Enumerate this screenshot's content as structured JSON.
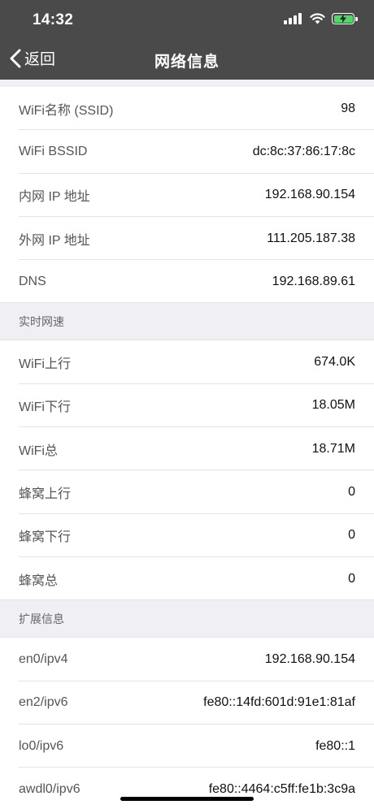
{
  "status_bar": {
    "time": "14:32"
  },
  "nav": {
    "back_label": "返回",
    "title": "网络信息"
  },
  "wifi_info": [
    {
      "label": "WiFi名称 (SSID)",
      "value": "98"
    },
    {
      "label": "WiFi BSSID",
      "value": "dc:8c:37:86:17:8c"
    },
    {
      "label": "内网 IP 地址",
      "value": "192.168.90.154"
    },
    {
      "label": "外网 IP 地址",
      "value": "111.205.187.38"
    },
    {
      "label": "DNS",
      "value": "192.168.89.61"
    }
  ],
  "realtime": {
    "header": "实时网速",
    "rows": [
      {
        "label": "WiFi上行",
        "value": "674.0K"
      },
      {
        "label": "WiFi下行",
        "value": "18.05M"
      },
      {
        "label": "WiFi总",
        "value": "18.71M"
      },
      {
        "label": "蜂窝上行",
        "value": "0"
      },
      {
        "label": "蜂窝下行",
        "value": "0"
      },
      {
        "label": "蜂窝总",
        "value": "0"
      }
    ]
  },
  "extended": {
    "header": "扩展信息",
    "rows": [
      {
        "label": "en0/ipv4",
        "value": "192.168.90.154"
      },
      {
        "label": "en2/ipv6",
        "value": "fe80::14fd:601d:91e1:81af"
      },
      {
        "label": "lo0/ipv6",
        "value": "fe80::1"
      },
      {
        "label": "awdl0/ipv6",
        "value": "fe80::4464:c5ff:fe1b:3c9a"
      }
    ]
  },
  "colors": {
    "navbar": "#4a4a4a",
    "background": "#efeff4",
    "battery": "#4cd964"
  },
  "icons": [
    "signal-icon",
    "wifi-icon",
    "battery-charging-icon",
    "chevron-left-icon"
  ]
}
